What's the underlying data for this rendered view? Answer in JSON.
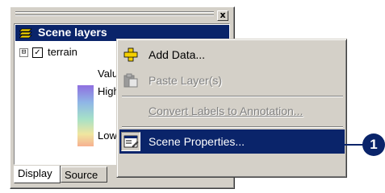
{
  "panel": {
    "close_label": "x",
    "title": "Scene layers",
    "layer": {
      "expander": "⊟",
      "checked": "✓",
      "name": "terrain"
    },
    "legend": {
      "field": "Value",
      "high": "High",
      "low": "Low :"
    },
    "tabs": [
      {
        "label": "Display"
      },
      {
        "label": "Source"
      }
    ]
  },
  "context_menu": {
    "items": [
      {
        "label": "Add Data...",
        "icon": "add-data-icon",
        "enabled": true
      },
      {
        "label": "Paste Layer(s)",
        "icon": "paste-icon",
        "enabled": false
      },
      {
        "label": "Convert Labels to Annotation...",
        "icon": "",
        "enabled": false
      },
      {
        "label": "Scene Properties...",
        "icon": "properties-icon",
        "enabled": true,
        "selected": true
      }
    ]
  },
  "callout": {
    "number": "1"
  },
  "colors": {
    "selection": "#0a246a",
    "face": "#d4d0c8"
  }
}
